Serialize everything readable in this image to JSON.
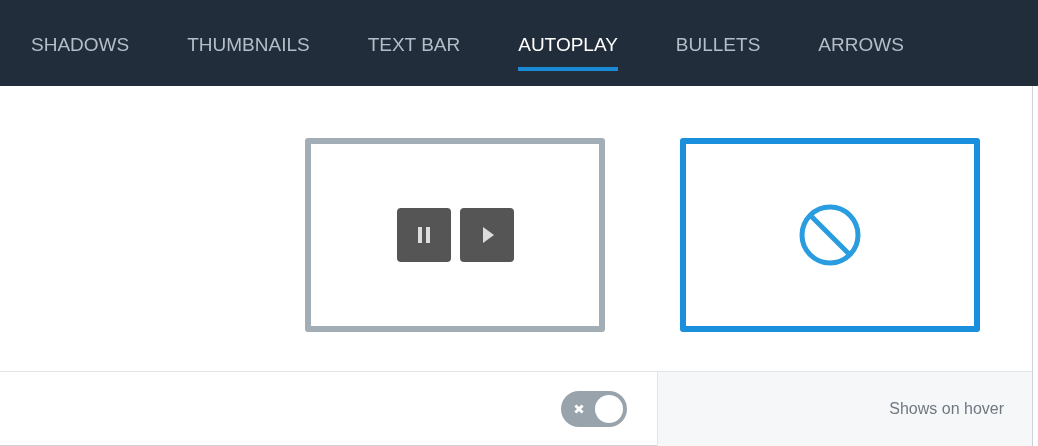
{
  "tabs": [
    {
      "label": "SHADOWS",
      "selected": false
    },
    {
      "label": "THUMBNAILS",
      "selected": false
    },
    {
      "label": "TEXT BAR",
      "selected": false
    },
    {
      "label": "AUTOPLAY",
      "selected": true
    },
    {
      "label": "BULLETS",
      "selected": false
    },
    {
      "label": "ARROWS",
      "selected": false
    }
  ],
  "options": [
    {
      "kind": "pause-play",
      "selected": false
    },
    {
      "kind": "none",
      "selected": true
    }
  ],
  "toggle": {
    "on": false
  },
  "hint": "Shows on hover"
}
